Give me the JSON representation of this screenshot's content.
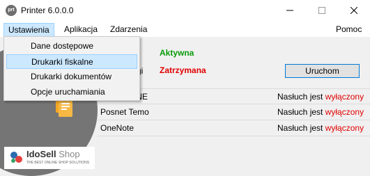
{
  "window": {
    "title": "Printer 6.0.0.0",
    "icon_text": "prt"
  },
  "menubar": {
    "items": [
      "Ustawienia",
      "Aplikacja",
      "Zdarzenia"
    ],
    "help": "Pomoc"
  },
  "dropdown": {
    "items": [
      "Dane dostępowe",
      "Drukarki fiskalne",
      "Drukarki dokumentów",
      "Opcje uruchamiania"
    ],
    "selected_index": 1
  },
  "status": {
    "row1_value": "Aktywna",
    "row2_label": "gi",
    "row2_value": "Zatrzymana",
    "run_button": "Uruchom"
  },
  "printers": [
    {
      "name": "E R ONLINE",
      "status_label": "Nasłuch jest",
      "status_value": "wyłączony"
    },
    {
      "name": "Posnet Temo",
      "status_label": "Nasłuch jest",
      "status_value": "wyłączony"
    },
    {
      "name": "OneNote",
      "status_label": "Nasłuch jest",
      "status_value": "wyłączony"
    }
  ],
  "logo": {
    "brand": "IdoSell",
    "brand_suffix": " Shop",
    "tagline": "THE BEST ONLINE SHOP SOLUTIONS"
  },
  "colors": {
    "active": "#0a9a0a",
    "stopped": "#e00000",
    "menu_highlight": "#cce8ff"
  }
}
